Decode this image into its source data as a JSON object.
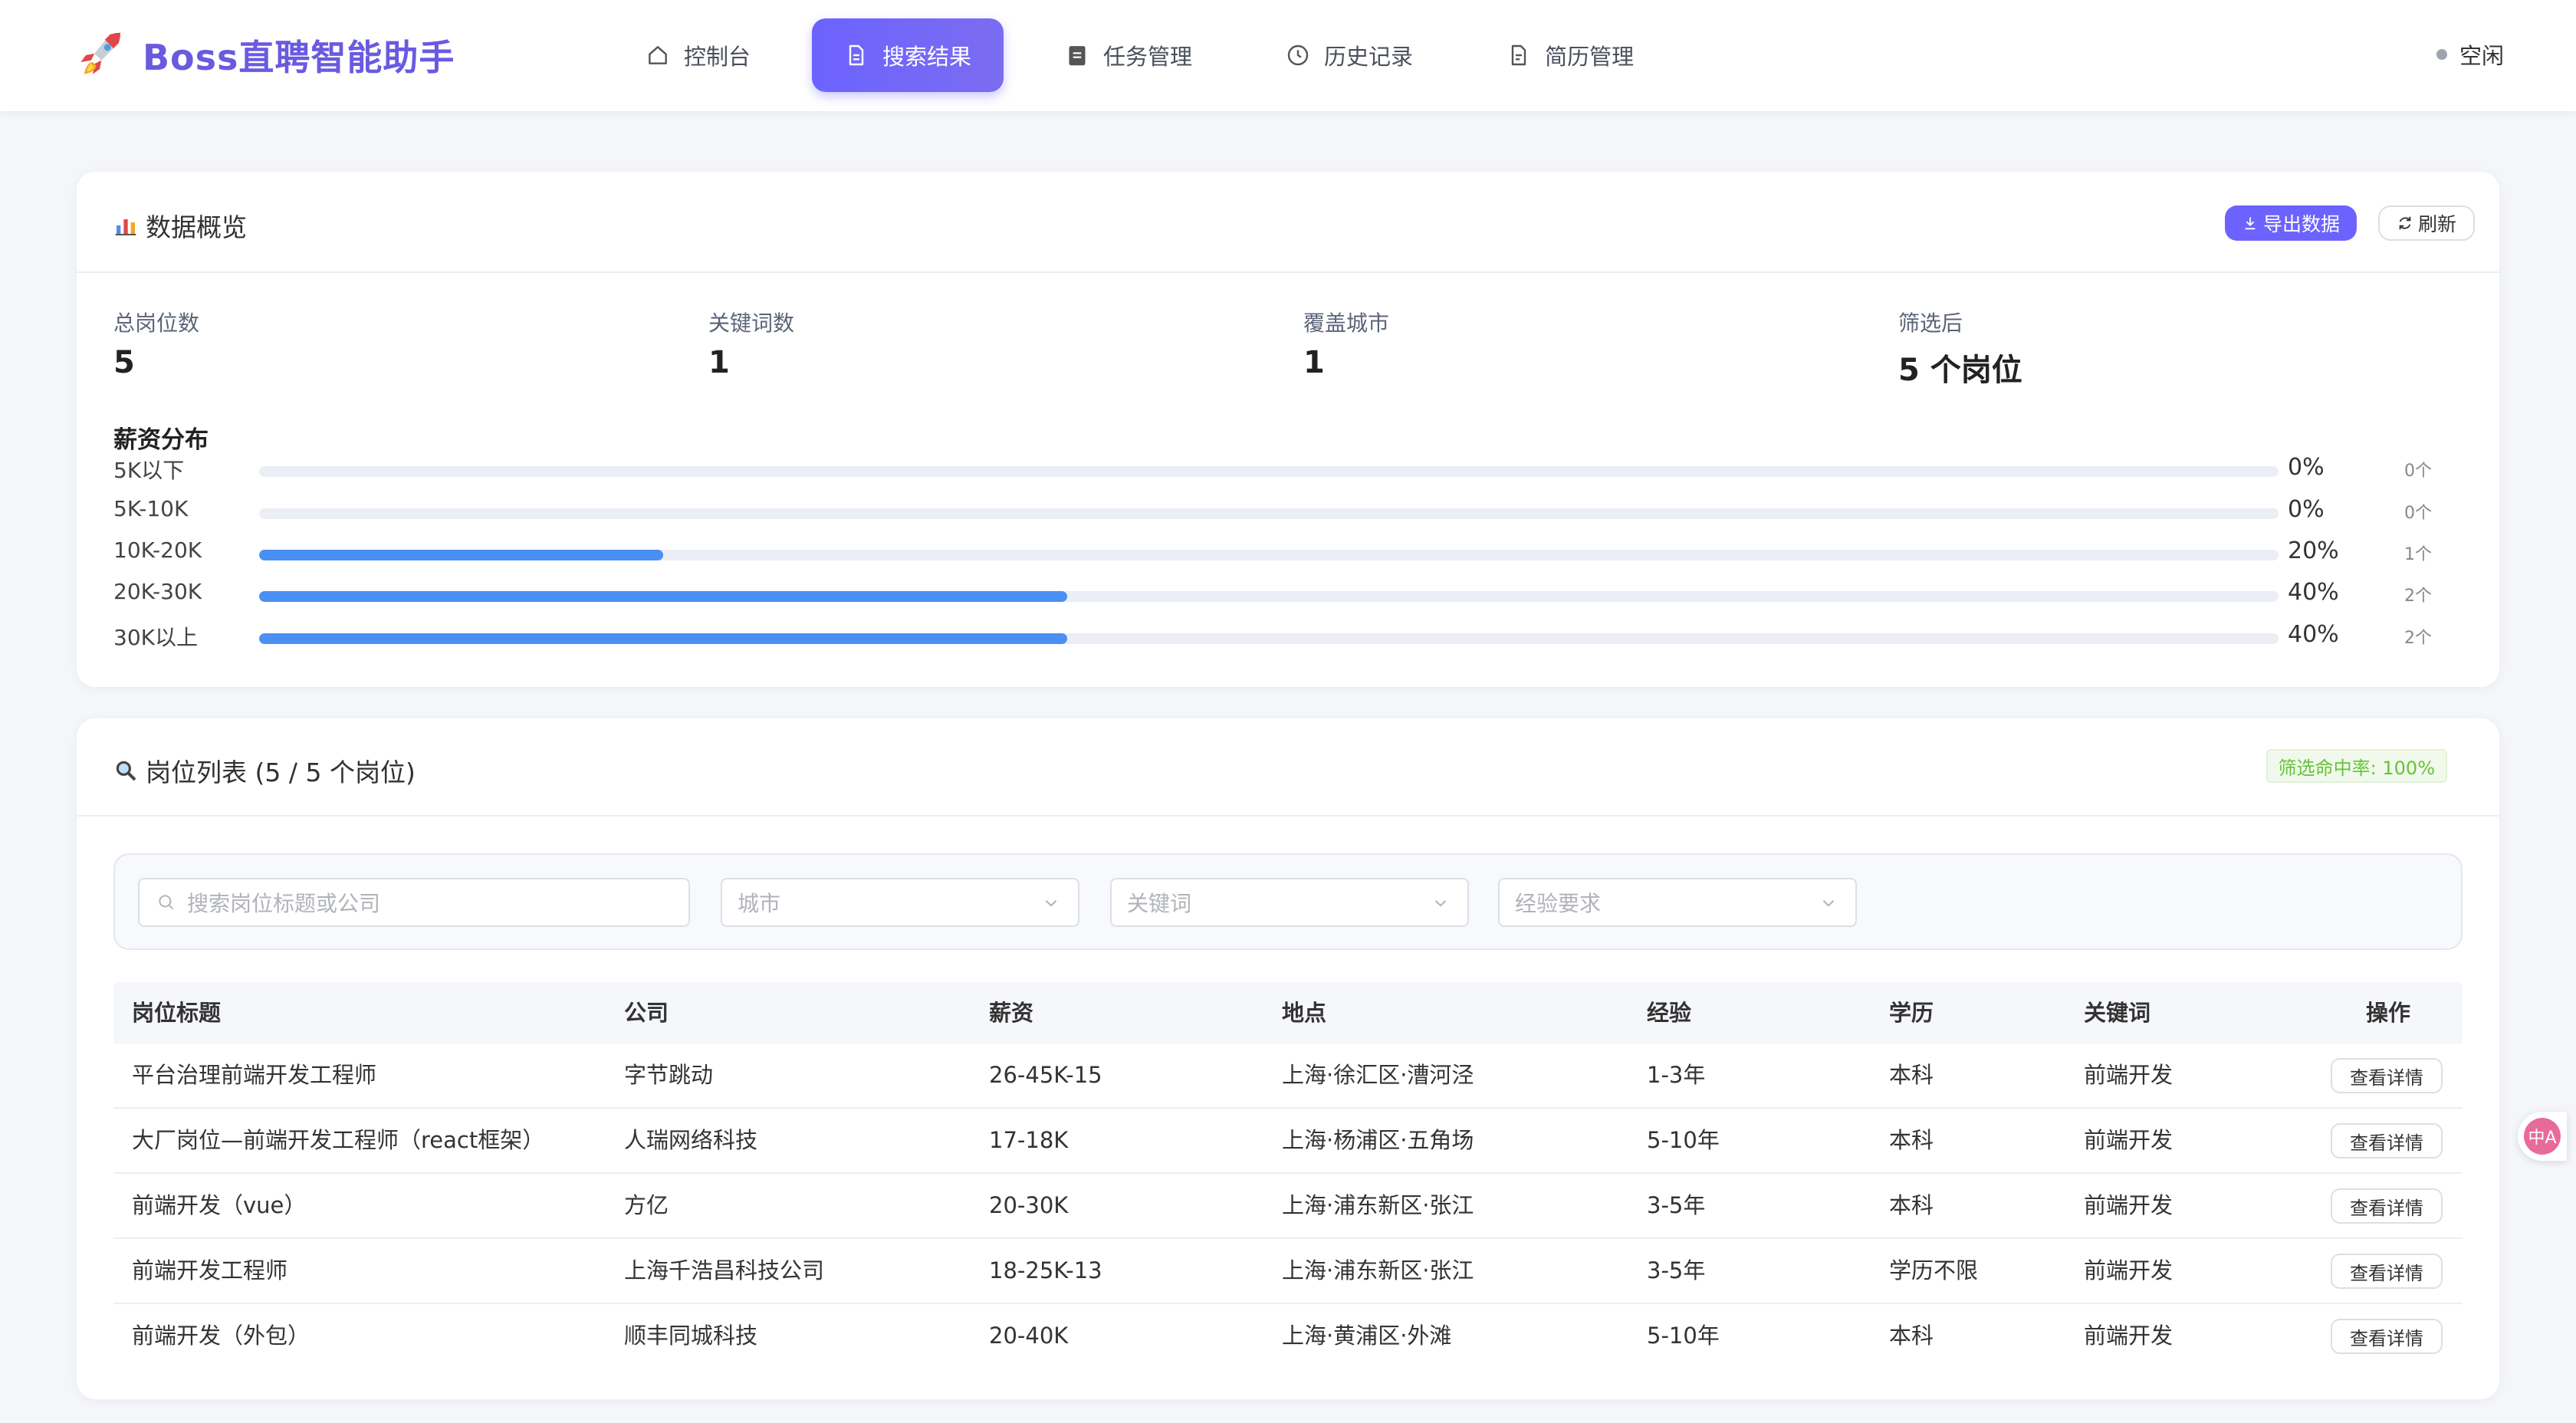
{
  "app": {
    "title": "Boss直聘智能助手",
    "accent_color": "#6c63ff",
    "status": "空闲"
  },
  "nav": {
    "items": [
      {
        "label": "控制台",
        "icon": "home-icon"
      },
      {
        "label": "搜索结果",
        "icon": "document-icon",
        "active": true
      },
      {
        "label": "任务管理",
        "icon": "clipboard-icon"
      },
      {
        "label": "历史记录",
        "icon": "clock-icon"
      },
      {
        "label": "简历管理",
        "icon": "file-icon"
      }
    ]
  },
  "overview": {
    "title": "数据概览",
    "export_label": "导出数据",
    "refresh_label": "刷新",
    "stats": [
      {
        "label": "总岗位数",
        "value": "5"
      },
      {
        "label": "关键词数",
        "value": "1"
      },
      {
        "label": "覆盖城市",
        "value": "1"
      },
      {
        "label": "筛选后",
        "value": "5 个岗位"
      }
    ],
    "distribution_title": "薪资分布",
    "distribution": [
      {
        "label": "5K以下",
        "percent": 0,
        "percent_text": "0%",
        "count": "0个"
      },
      {
        "label": "5K-10K",
        "percent": 0,
        "percent_text": "0%",
        "count": "0个"
      },
      {
        "label": "10K-20K",
        "percent": 20,
        "percent_text": "20%",
        "count": "1个"
      },
      {
        "label": "20K-30K",
        "percent": 40,
        "percent_text": "40%",
        "count": "2个"
      },
      {
        "label": "30K以上",
        "percent": 40,
        "percent_text": "40%",
        "count": "2个"
      }
    ]
  },
  "jobs": {
    "title": "岗位列表 (5 / 5 个岗位)",
    "hit_rate": "筛选命中率: 100%",
    "filters": {
      "search_placeholder": "搜索岗位标题或公司",
      "city_placeholder": "城市",
      "keyword_placeholder": "关键词",
      "experience_placeholder": "经验要求"
    },
    "columns": [
      "岗位标题",
      "公司",
      "薪资",
      "地点",
      "经验",
      "学历",
      "关键词",
      "操作"
    ],
    "detail_label": "查看详情",
    "rows": [
      {
        "title": "平台治理前端开发工程师",
        "company": "字节跳动",
        "salary": "26-45K-15",
        "location": "上海·徐汇区·漕河泾",
        "experience": "1-3年",
        "education": "本科",
        "keyword": "前端开发"
      },
      {
        "title": "大厂岗位—前端开发工程师（react框架）",
        "company": "人瑞网络科技",
        "salary": "17-18K",
        "location": "上海·杨浦区·五角场",
        "experience": "5-10年",
        "education": "本科",
        "keyword": "前端开发"
      },
      {
        "title": "前端开发（vue）",
        "company": "方亿",
        "salary": "20-30K",
        "location": "上海·浦东新区·张江",
        "experience": "3-5年",
        "education": "本科",
        "keyword": "前端开发"
      },
      {
        "title": "前端开发工程师",
        "company": "上海千浩昌科技公司",
        "salary": "18-25K-13",
        "location": "上海·浦东新区·张江",
        "experience": "3-5年",
        "education": "学历不限",
        "keyword": "前端开发"
      },
      {
        "title": "前端开发（外包）",
        "company": "顺丰同城科技",
        "salary": "20-40K",
        "location": "上海·黄浦区·外滩",
        "experience": "5-10年",
        "education": "本科",
        "keyword": "前端开发"
      }
    ]
  },
  "floating": {
    "icon": "translate-icon",
    "label": "中A"
  }
}
